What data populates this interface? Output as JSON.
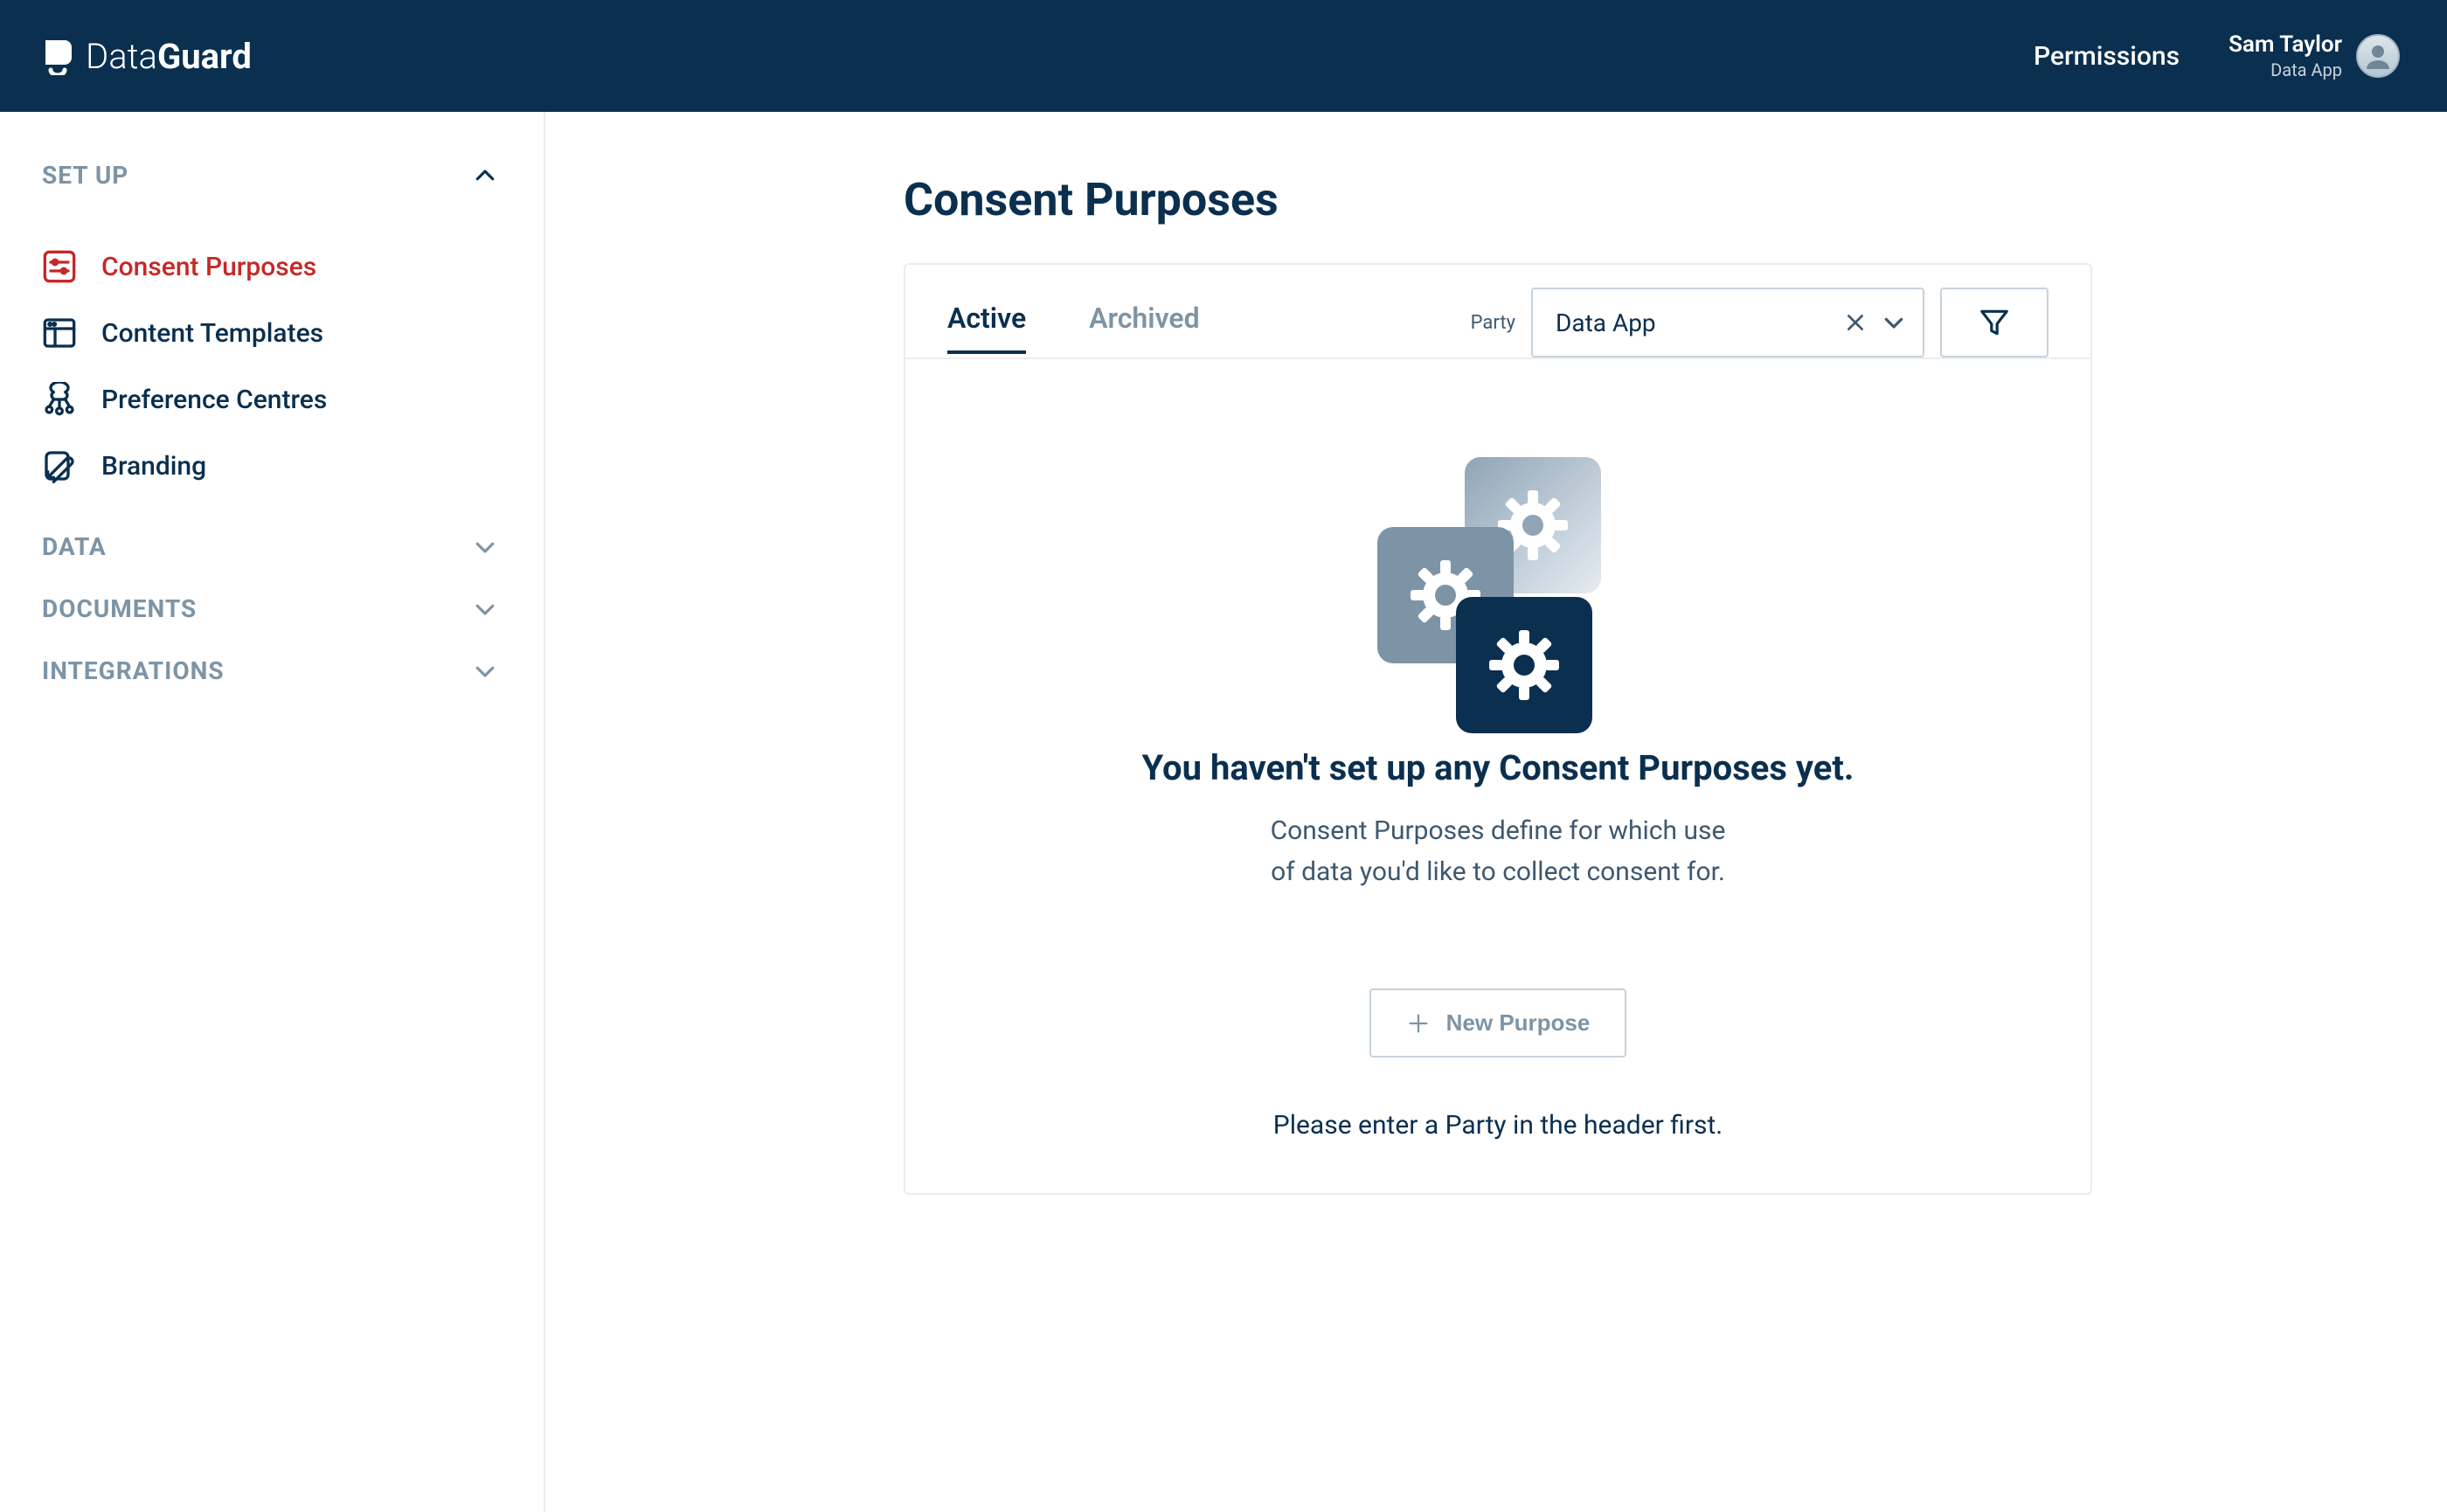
{
  "brand": {
    "name_light": "Data",
    "name_bold": "Guard"
  },
  "header": {
    "link_permissions": "Permissions",
    "user_name": "Sam Taylor",
    "user_sub": "Data App"
  },
  "sidebar": {
    "groups": [
      {
        "title": "SET UP",
        "expanded": true
      },
      {
        "title": "DATA",
        "expanded": false
      },
      {
        "title": "DOCUMENTS",
        "expanded": false
      },
      {
        "title": "INTEGRATIONS",
        "expanded": false
      }
    ],
    "setup_items": [
      {
        "label": "Consent Purposes"
      },
      {
        "label": "Content Templates"
      },
      {
        "label": "Preference Centres"
      },
      {
        "label": "Branding"
      }
    ]
  },
  "page": {
    "title": "Consent Purposes",
    "tabs": {
      "active": "Active",
      "archived": "Archived"
    },
    "party": {
      "label": "Party",
      "value": "Data App"
    },
    "empty": {
      "title": "You haven't set up any Consent Purposes yet.",
      "desc_line1": "Consent Purposes define for which use",
      "desc_line2": "of data you'd like to collect consent for.",
      "new_button": "New Purpose",
      "hint": "Please enter a Party in the header first."
    }
  }
}
